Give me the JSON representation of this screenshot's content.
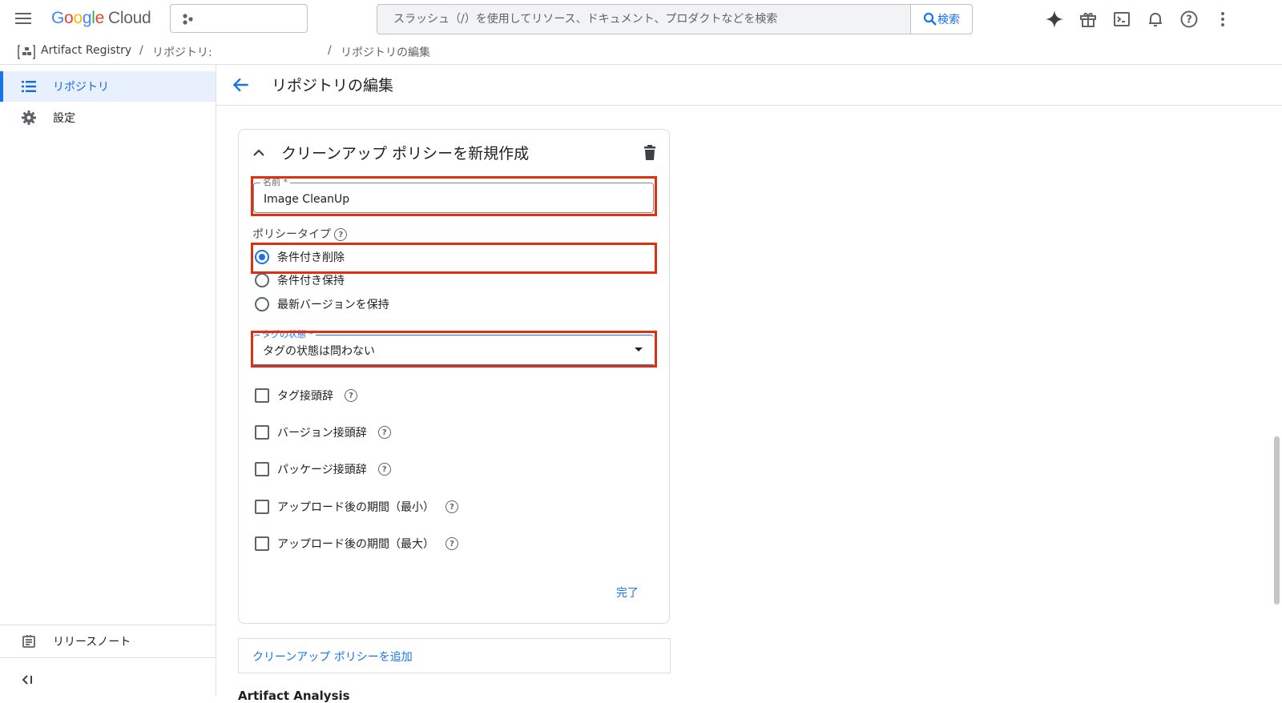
{
  "topbar": {
    "logo_parts": [
      "G",
      "o",
      "o",
      "g",
      "l",
      "e"
    ],
    "logo_cloud": "Cloud",
    "search_placeholder": "スラッシュ（/）を使用してリソース、ドキュメント、プロダクトなどを検索",
    "search_button": "検索",
    "icons": [
      "gemini-sparkle-icon",
      "gift-icon",
      "cloud-shell-icon",
      "notifications-bell-icon",
      "help-icon",
      "more-vert-icon"
    ]
  },
  "breadcrumb": {
    "product": "Artifact Registry",
    "sep1": "/",
    "repos": "リポジトリ:",
    "sep2": "/",
    "current": "リポジトリの編集"
  },
  "sidebar": {
    "items": [
      {
        "label": "リポジトリ",
        "icon": "list-icon",
        "active": true
      },
      {
        "label": "設定",
        "icon": "gear-icon",
        "active": false
      }
    ],
    "release_notes": "リリースノート",
    "collapse_icon": "collapse-sidebar-icon"
  },
  "page": {
    "title": "リポジトリの編集"
  },
  "policy_card": {
    "title": "クリーンアップ ポリシーを新規作成",
    "name_label": "名前 *",
    "name_value": "Image CleanUp",
    "policy_type_label": "ポリシータイプ",
    "policy_types": [
      {
        "label": "条件付き削除",
        "selected": true
      },
      {
        "label": "条件付き保持",
        "selected": false
      },
      {
        "label": "最新バージョンを保持",
        "selected": false
      }
    ],
    "tag_state_label": "タグの状態 *",
    "tag_state_value": "タグの状態は問わない",
    "conditions": [
      {
        "label": "タグ接頭辞",
        "checked": false
      },
      {
        "label": "バージョン接頭辞",
        "checked": false
      },
      {
        "label": "パッケージ接頭辞",
        "checked": false
      },
      {
        "label": "アップロード後の期間（最小）",
        "checked": false
      },
      {
        "label": "アップロード後の期間（最大）",
        "checked": false
      }
    ],
    "done": "完了"
  },
  "add_policy": "クリーンアップ ポリシーを追加",
  "next_section": "Artifact Analysis",
  "colors": {
    "accent": "#1a73e8",
    "highlight": "#e0300f",
    "active_nav_bg": "#e8f0fe"
  }
}
